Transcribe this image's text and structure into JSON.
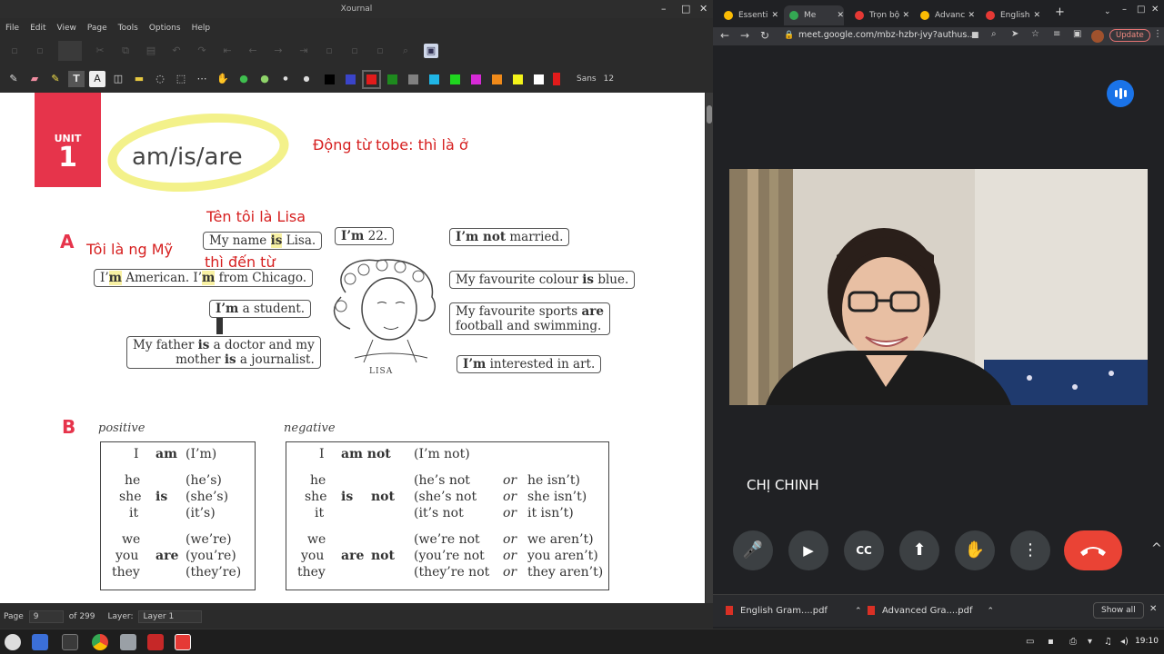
{
  "xournal": {
    "title": "Xournal",
    "menu": [
      "File",
      "Edit",
      "View",
      "Page",
      "Tools",
      "Options",
      "Help"
    ],
    "font_name": "Sans",
    "font_size": "12",
    "colors": [
      "#000000",
      "#3a44c9",
      "#e21b1b",
      "#1e8a1e",
      "#808080",
      "#20b6e6",
      "#1fd61f",
      "#d62ad6",
      "#f08a1a",
      "#f3f31a",
      "#ffffff"
    ],
    "status": {
      "page_label": "Page",
      "page_value": "9",
      "page_total": "of 299",
      "layer_label": "Layer:",
      "layer_value": "Layer 1"
    },
    "page": {
      "unit_label": "UNIT",
      "unit_number": "1",
      "unit_title": "am/is/are",
      "note_tobe": "Động từ tobe: thì là ở",
      "note_name": "Tên tôi là Lisa",
      "note_american": "Tôi là ng Mỹ",
      "note_from": "thì đến từ",
      "section_a": "A",
      "section_b": "B",
      "lisa": "LISA",
      "bubbles": {
        "name_pre": "My name ",
        "name_is": "is",
        "name_post": " Lisa.",
        "age_im": "I’m",
        "age_rest": " 22.",
        "american_i": "I’",
        "american_m": "m",
        "american_rest": " American. I’",
        "american_m2": "m",
        "american_tail": " from Chicago.",
        "student_im": "I’m",
        "student_rest": " a student.",
        "father_1": "My father ",
        "father_is": "is",
        "father_2": " a doctor and my",
        "mother_1": "mother ",
        "mother_is": "is",
        "mother_2": " a journalist.",
        "married_im": "I’m",
        "married_not": " not",
        "married_rest": " married.",
        "colour_pre": "My favourite colour ",
        "colour_is": "is",
        "colour_post": " blue.",
        "sports_pre": "My favourite sports ",
        "sports_are": "are",
        "sports_2": "football and swimming.",
        "art_im": "I’m",
        "art_rest": " interested in art."
      },
      "positive_label": "positive",
      "negative_label": "negative",
      "positive": {
        "i": "I",
        "am": "am",
        "i_short": "(I’m)",
        "he": "he",
        "she": "she",
        "it": "it",
        "is": "is",
        "he_short": "(he’s)",
        "she_short": "(she’s)",
        "it_short": "(it’s)",
        "we": "we",
        "you": "you",
        "they": "they",
        "are": "are",
        "we_short": "(we’re)",
        "you_short": "(you’re)",
        "they_short": "(they’re)"
      },
      "negative": {
        "i": "I",
        "am_not": "am  not",
        "i_short": "(I’m not)",
        "he": "he",
        "she": "she",
        "it": "it",
        "is": "is",
        "not": "not",
        "he_short": "(he’s not",
        "she_short": "(she’s not",
        "it_short": "(it’s not",
        "or": "or",
        "he_alt": "he isn’t)",
        "she_alt": "she isn’t)",
        "it_alt": "it isn’t)",
        "we": "we",
        "you": "you",
        "they": "they",
        "are": "are",
        "we_short": "(we’re not",
        "you_short": "(you’re not",
        "they_short": "(they’re not",
        "we_alt": "we aren’t)",
        "you_alt": "you aren’t)",
        "they_alt": "they aren’t)"
      }
    }
  },
  "chrome": {
    "tabs": [
      {
        "label": "Essenti",
        "color": "#fbbc04"
      },
      {
        "label": "Me",
        "color": "#34a853"
      },
      {
        "label": "Trọn bộ",
        "color": "#e53935"
      },
      {
        "label": "Advanc",
        "color": "#fbbc04"
      },
      {
        "label": "English",
        "color": "#e53935"
      }
    ],
    "url": "meet.google.com/mbz-hzbr-jvy?authus...",
    "update_label": "Update",
    "participant_name": "CHỊ CHINH",
    "downloads": [
      "English Gram....pdf",
      "Advanced Gra....pdf"
    ],
    "show_all": "Show all"
  },
  "taskbar": {
    "clock": "19:10"
  }
}
